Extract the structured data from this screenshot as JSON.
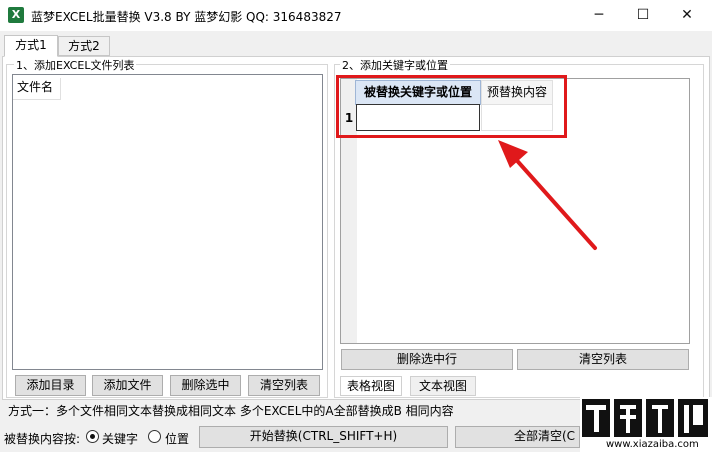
{
  "window": {
    "title": "蓝梦EXCEL批量替换 V3.8 BY 蓝梦幻影 QQ: 316483827",
    "minimize_glyph": "─",
    "maximize_glyph": "☐",
    "close_glyph": "✕",
    "icon_glyph": "X"
  },
  "tabs": [
    {
      "label": "方式1",
      "active": true
    },
    {
      "label": "方式2",
      "active": false
    }
  ],
  "left_panel": {
    "group_label": "1、添加EXCEL文件列表",
    "column_header": "文件名",
    "buttons": [
      "添加目录",
      "添加文件",
      "删除选中",
      "清空列表"
    ]
  },
  "right_panel": {
    "group_label": "2、添加关键字或位置",
    "grid": {
      "headers": [
        "被替换关键字或位置",
        "预替换内容"
      ],
      "row_number": "1",
      "cell_value": ""
    },
    "buttons": [
      "删除选中行",
      "清空列表"
    ],
    "view_tabs": [
      {
        "label": "表格视图",
        "active": true
      },
      {
        "label": "文本视图",
        "active": false
      }
    ]
  },
  "footer": {
    "description": "方式一：多个文件相同文本替换成相同文本  多个EXCEL中的A全部替换成B 相同内容",
    "replace_by_label": "被替换内容按:",
    "radio_options": [
      {
        "label": "关键字",
        "checked": true
      },
      {
        "label": "位置",
        "checked": false
      }
    ],
    "start_button": "开始替换(CTRL_SHIFT+H)",
    "clear_button": "全部清空(C"
  },
  "watermark": {
    "brand": "下载吧",
    "url": "www.xiazaiba.com"
  },
  "colors": {
    "highlight_box": "#e0191b",
    "arrow": "#e0191b"
  }
}
